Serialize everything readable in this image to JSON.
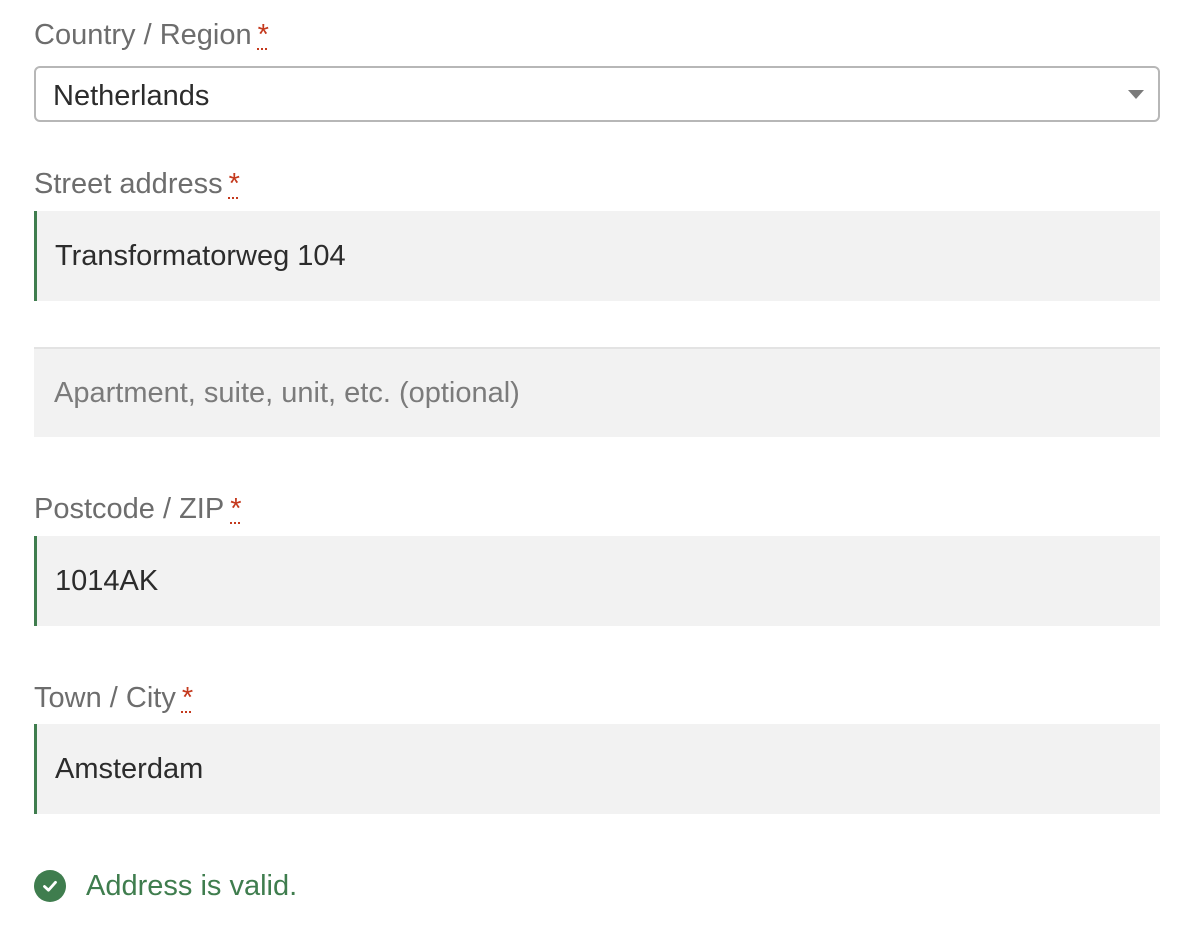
{
  "country": {
    "label": "Country / Region",
    "required_mark": "*",
    "value": "Netherlands"
  },
  "street": {
    "label": "Street address",
    "required_mark": "*",
    "value": "Transformatorweg 104"
  },
  "apartment": {
    "value": "",
    "placeholder": "Apartment, suite, unit, etc. (optional)"
  },
  "postcode": {
    "label": "Postcode / ZIP",
    "required_mark": "*",
    "value": "1014AK"
  },
  "city": {
    "label": "Town / City",
    "required_mark": "*",
    "value": "Amsterdam"
  },
  "validation": {
    "message": "Address is valid.",
    "icon": "check-circle-icon",
    "color": "#3f7d4e"
  },
  "colors": {
    "required": "#c4391d",
    "valid_border": "#3f7d4e",
    "field_background": "#f2f2f2"
  }
}
